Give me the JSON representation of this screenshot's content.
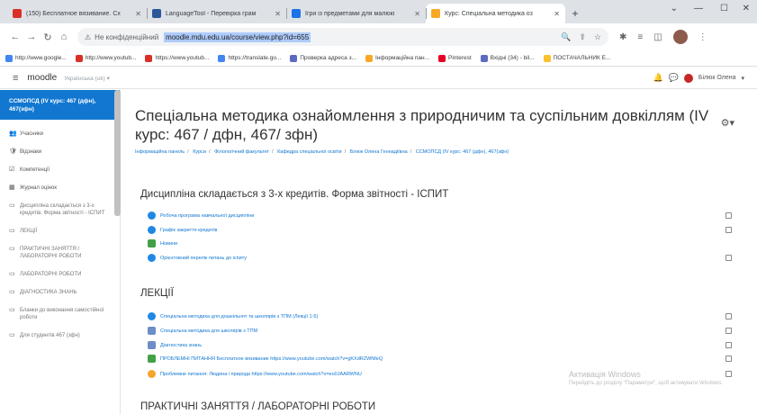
{
  "browser": {
    "tabs": [
      {
        "title": "(150) Бесплатное вязивание. Сх",
        "color": "#d93025",
        "active": false
      },
      {
        "title": "LanguageTool - Перевірка грам",
        "color": "#2b579a",
        "active": false
      },
      {
        "title": "Ігри із предметами для малюкі",
        "color": "#1a73e8",
        "active": false
      },
      {
        "title": "Курс: Спеціальна методика оз",
        "color": "#f9a825",
        "active": true
      }
    ],
    "new_tab": "+",
    "address_warning": "Не конфіденційний",
    "url": "moodle.mdu.edu.ua/course/view.php?id=655",
    "bookmarks": [
      {
        "label": "http://www.google...",
        "color": "#4285f4"
      },
      {
        "label": "http://www.youtub...",
        "color": "#d93025"
      },
      {
        "label": "https://www.youtub...",
        "color": "#d93025"
      },
      {
        "label": "https://translate.go...",
        "color": "#4285f4"
      },
      {
        "label": "Проверка адреса з...",
        "color": "#5c6bc0"
      },
      {
        "label": "Інформаційна пан...",
        "color": "#f9a825"
      },
      {
        "label": "Pinterest",
        "color": "#e60023"
      },
      {
        "label": "Вхідні (34) - bil...",
        "color": "#5c6bc0"
      },
      {
        "label": "ПОСТАЧАЛЬНИК Е...",
        "color": "#fbc02d"
      }
    ]
  },
  "moodle": {
    "logo": "moodle",
    "lang": "Українська (uk) ▾",
    "user": "Білюк Олена"
  },
  "drawer": {
    "course": "ССМОПСД (IV курс: 467 (дфн), 467(зфн)",
    "items": [
      {
        "icon": "👥",
        "label": "Учасники",
        "section": false
      },
      {
        "icon": "🛡",
        "label": "Відзнаки",
        "section": false
      },
      {
        "icon": "☑",
        "label": "Компетенції",
        "section": false
      },
      {
        "icon": "▦",
        "label": "Журнал оцінок",
        "section": false
      },
      {
        "icon": "▭",
        "label": "Дисципліна складається з 3-х кредитів. Форма звітності - ІСПИТ",
        "section": true
      },
      {
        "icon": "▭",
        "label": "ЛЕКЦІЇ",
        "section": true
      },
      {
        "icon": "▭",
        "label": "ПРАКТИЧНІ ЗАНЯТТЯ / ЛАБОРАТОРНІ РОБОТИ",
        "section": true
      },
      {
        "icon": "▭",
        "label": "ЛАБОРАТОРНІ РОБОТИ",
        "section": true
      },
      {
        "icon": "▭",
        "label": "ДІАГНОСТИКА ЗНАНЬ",
        "section": true
      },
      {
        "icon": "▭",
        "label": "Бланки до виконання самостійної роботи",
        "section": true
      },
      {
        "icon": "▭",
        "label": "Для студентів 467 (зфн)",
        "section": true
      }
    ]
  },
  "page": {
    "title": "Спеціальна методика ознайомлення з природничим та суспільним довкіллям (IV курс: 467 / дфн, 467/ зфн)",
    "breadcrumb": [
      "Інформаційна панель",
      "Курси",
      "Філологічний факультет",
      "Кафедра спеціальної освіти",
      "Білюк Олена Геннадіївна",
      "ССМОПСД (IV курс: 467 (дфн), 467(зфн)"
    ]
  },
  "sections": [
    {
      "title": "Дисципліна складається з 3-х кредитів. Форма звітності - ІСПИТ",
      "items": [
        {
          "type": "url",
          "label": "Робоча програма навчальної дисципліни"
        },
        {
          "type": "url",
          "label": "Графік закриття кредитів"
        },
        {
          "type": "forum",
          "label": "Новини"
        },
        {
          "type": "url",
          "label": "Орієнтовний перелік питань до іспиту"
        }
      ]
    },
    {
      "title": "ЛЕКЦІЇ",
      "items": [
        {
          "type": "url",
          "label": "Спеціальна методика для дошкільнят та школярів з ТПМ (Лекції 1-5)"
        },
        {
          "type": "doc",
          "label": "Спеціальна методика для школярів з ТПМ"
        },
        {
          "type": "doc",
          "label": "Діагностика знань"
        },
        {
          "type": "forum",
          "label": "ПРОБЛЕМНІ ПИТАННЯ Бесплатное вязивание https://www.youtube.com/watch?v=gKXdRZWNfeQ"
        },
        {
          "type": "quiz",
          "label": "Проблемне питання: Людина і природа https://www.youtube.com/watch?v=eo0JAARWNU"
        }
      ]
    },
    {
      "title": "ПРАКТИЧНІ ЗАНЯТТЯ / ЛАБОРАТОРНІ РОБОТИ",
      "items": []
    }
  ],
  "watermark": {
    "line1": "Активація Windows",
    "line2": "Перейдіть до розділу \"Параметри\", щоб активувати Windows."
  }
}
